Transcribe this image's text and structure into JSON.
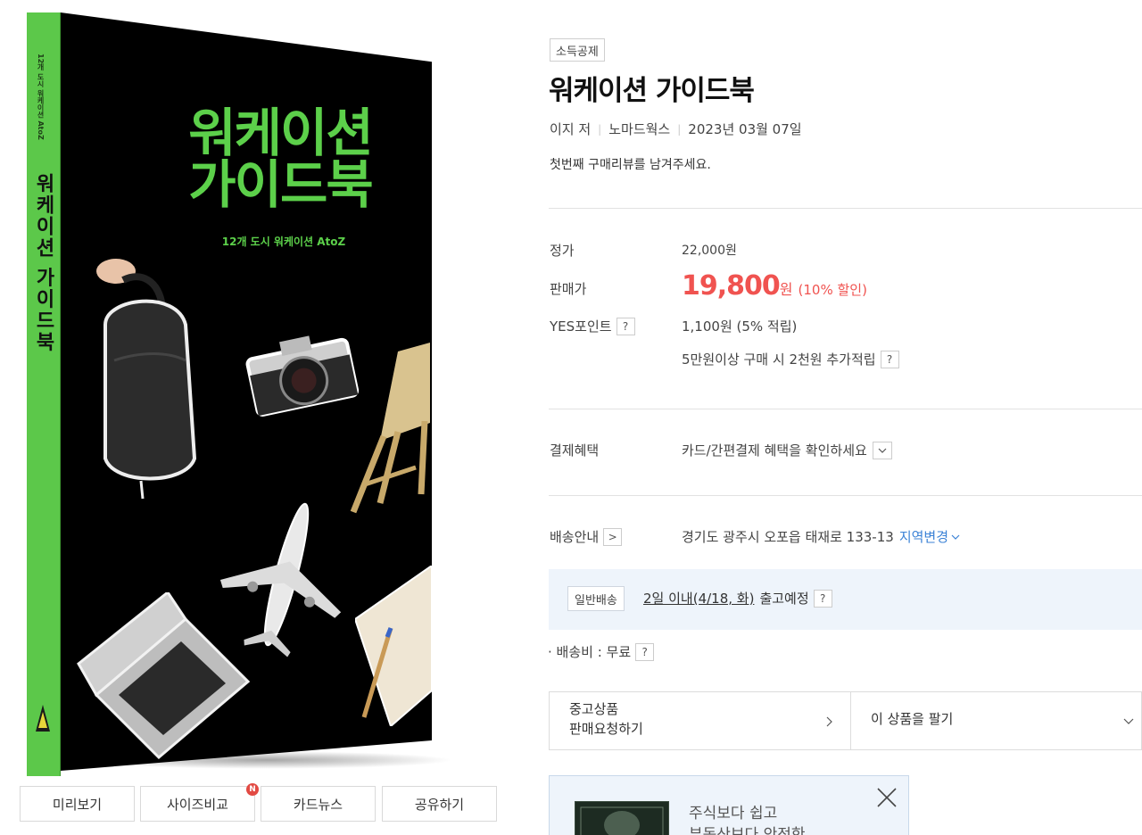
{
  "book": {
    "cover_title": "워케이션 가이드북",
    "cover_subtitle": "12개 도시 워케이션 AtoZ",
    "spine_title": "워케이션 가이드북",
    "spine_small": "12개 도시 워케이션 AtoZ"
  },
  "cover_buttons": [
    {
      "label": "미리보기"
    },
    {
      "label": "사이즈비교",
      "badge": "N"
    },
    {
      "label": "카드뉴스"
    },
    {
      "label": "공유하기"
    }
  ],
  "product": {
    "tag": "소득공제",
    "title": "워케이션 가이드북",
    "author": "이지 저",
    "publisher": "노마드웍스",
    "date": "2023년 03월 07일",
    "review_prompt": "첫번째 구매리뷰를 남겨주세요."
  },
  "price": {
    "list_label": "정가",
    "list_value": "22,000원",
    "sale_label": "판매가",
    "sale_amount": "19,800",
    "sale_unit": "원",
    "discount": "(10% 할인)",
    "point_label": "YES포인트",
    "point_value": "1,100원 (5% 적립)",
    "extra_point": "5만원이상 구매 시 2천원 추가적립",
    "help": "?"
  },
  "payment": {
    "label": "결제혜택",
    "value": "카드/간편결제 혜택을 확인하세요"
  },
  "shipping": {
    "label": "배송안내",
    "arrow": ">",
    "address": "경기도 광주시 오포읍 태재로 133-13",
    "change_region": "지역변경",
    "chip": "일반배송",
    "eta_link": "2일 이내(4/18, 화)",
    "eta_suffix": "출고예정",
    "fee": "· 배송비 : 무료"
  },
  "used": {
    "line1": "중고상품",
    "line2": "판매요청하기",
    "sell": "이 상품을 팔기"
  },
  "ad": {
    "line1": "주식보다 쉽고",
    "line2": "부동산보다 안전한"
  }
}
